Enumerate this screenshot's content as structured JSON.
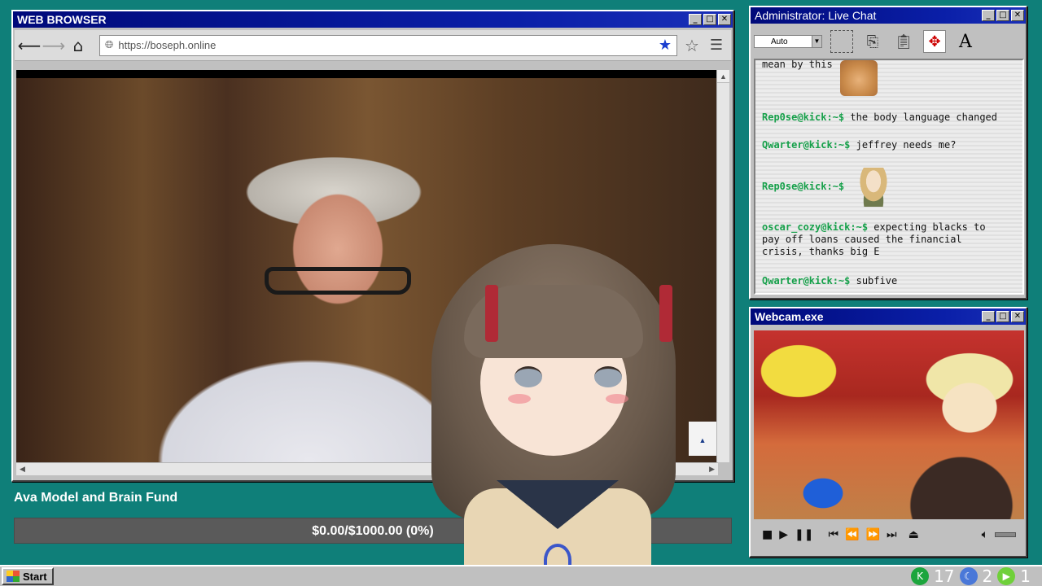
{
  "browser": {
    "title": "WEB BROWSER",
    "url": "https://boseph.online",
    "min_label": "_",
    "max_label": "□",
    "close_label": "✕"
  },
  "chat": {
    "title": "Administrator: Live Chat",
    "font_select": "Auto",
    "messages": [
      {
        "user": "",
        "text": "mean by this",
        "emote": "cat-emote"
      },
      {
        "user": "Rep0se@kick:~$",
        "text": "the body language changed"
      },
      {
        "user": "Qwarter@kick:~$",
        "text": "jeffrey needs me?"
      },
      {
        "user": "Rep0se@kick:~$",
        "text": "",
        "emote": "girl-emote"
      },
      {
        "user": "oscar_cozy@kick:~$",
        "text": "expecting blacks to pay off loans caused the financial crisis, thanks big E"
      },
      {
        "user": "Qwarter@kick:~$",
        "text": "subfive"
      }
    ]
  },
  "webcam": {
    "title": "Webcam.exe"
  },
  "fund": {
    "title": "Ava Model and Brain Fund",
    "progress_text": "$0.00/$1000.00 (0%)",
    "progress": 0
  },
  "taskbar": {
    "start_label": "Start",
    "tray_counts": [
      "17",
      "2",
      "1"
    ]
  },
  "colors": {
    "titlebar": "#0a1fa8",
    "desktop": "#0f7f79",
    "chat_user": "#16a04a",
    "fund_fill": "#1aa34a"
  }
}
